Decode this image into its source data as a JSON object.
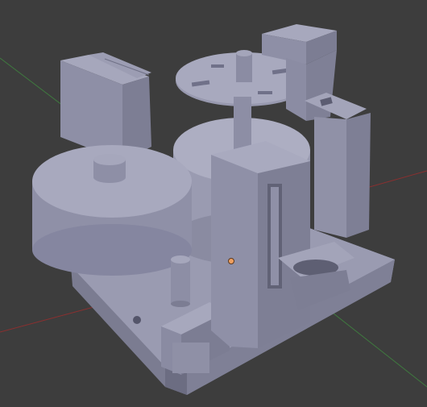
{
  "viewport": {
    "background": "#3d3d3d",
    "mode": "3d-viewport-solid",
    "object_color": "#8e8fa6",
    "x_axis_color": "#8a3030",
    "y_axis_color": "#3f7a3f",
    "origin_color": "#f0a060"
  },
  "scene": {
    "objects": [
      "base-plate",
      "large-cylinder",
      "center-drum",
      "top-disc",
      "front-bracket",
      "rear-left-block",
      "rear-right-post",
      "small-pin",
      "bottom-bracket",
      "ring-bracket"
    ]
  }
}
